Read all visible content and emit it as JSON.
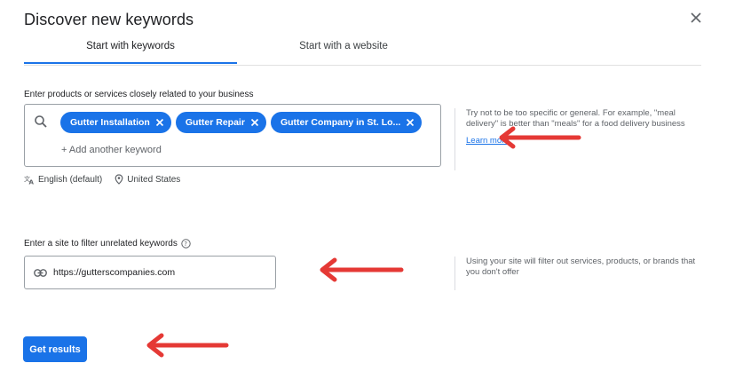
{
  "dialog": {
    "title": "Discover new keywords"
  },
  "tabs": [
    {
      "label": "Start with keywords",
      "active": true
    },
    {
      "label": "Start with a website",
      "active": false
    }
  ],
  "keywords_section": {
    "label": "Enter products or services closely related to your business",
    "chips": [
      "Gutter Installation",
      "Gutter Repair",
      "Gutter Company in St. Lo..."
    ],
    "add_placeholder": "+ Add another keyword",
    "language": "English (default)",
    "location": "United States",
    "hint": "Try not to be too specific or general. For example, \"meal delivery\" is better than \"meals\" for a food delivery business",
    "learn_more": "Learn more"
  },
  "site_section": {
    "label": "Enter a site to filter unrelated keywords",
    "value": "https://gutterscompanies.com",
    "hint": "Using your site will filter out services, products, or brands that you don't offer"
  },
  "actions": {
    "submit_label": "Get results"
  },
  "colors": {
    "accent": "#1a73e8",
    "annotation_arrow": "#e53935"
  },
  "icons": [
    "close-icon",
    "search-icon",
    "translate-icon",
    "location-pin-icon",
    "help-icon",
    "link-icon",
    "arrow-annotation"
  ]
}
